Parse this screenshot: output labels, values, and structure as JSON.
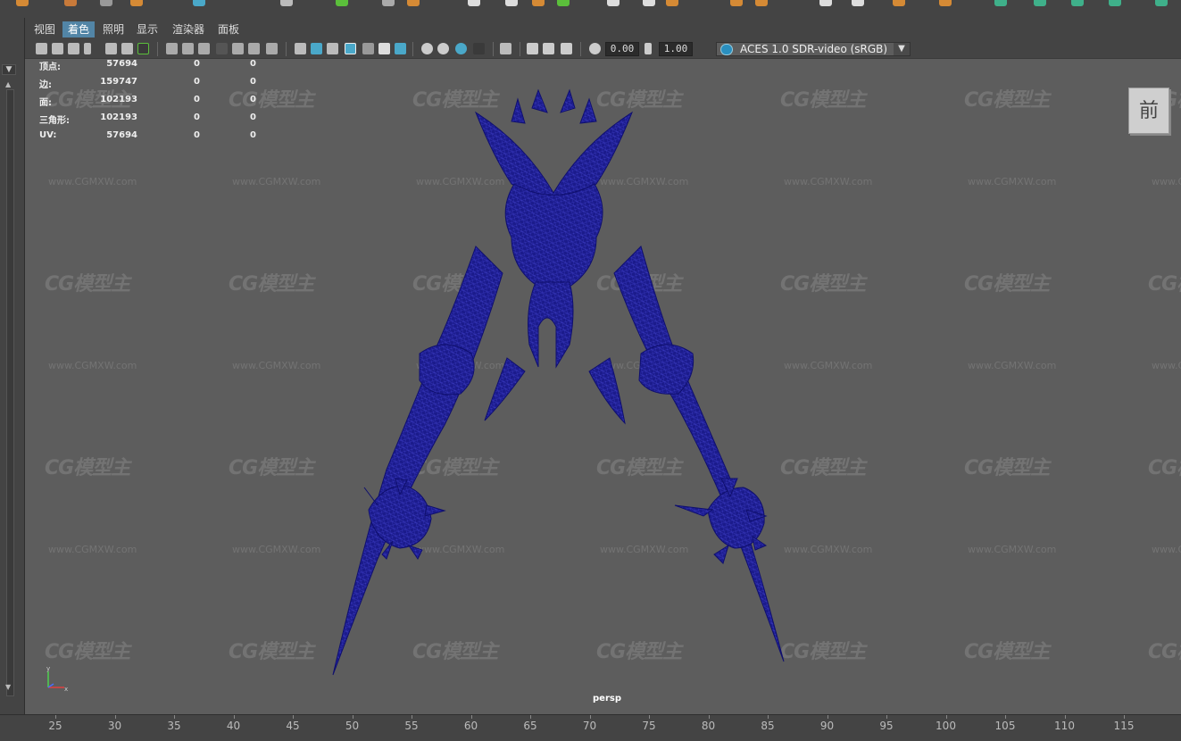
{
  "menu": {
    "items": [
      "视图",
      "着色",
      "照明",
      "显示",
      "渲染器",
      "面板"
    ],
    "active_index": 1
  },
  "toolbar": {
    "exposure_value": "0.00",
    "gamma_value": "1.00",
    "color_management": "ACES 1.0 SDR-video (sRGB)"
  },
  "hud": {
    "rows": [
      {
        "label": "顶点:",
        "v1": "57694",
        "v2": "0",
        "v3": "0"
      },
      {
        "label": "边:",
        "v1": "159747",
        "v2": "0",
        "v3": "0"
      },
      {
        "label": "面:",
        "v1": "102193",
        "v2": "0",
        "v3": "0"
      },
      {
        "label": "三角形:",
        "v1": "102193",
        "v2": "0",
        "v3": "0"
      },
      {
        "label": "UV:",
        "v1": "57694",
        "v2": "0",
        "v3": "0"
      }
    ]
  },
  "viewport": {
    "camera": "persp",
    "view_cube_face": "前",
    "axis_y": "y",
    "axis_x": "x",
    "watermark_logo": "CG模型主",
    "watermark_url": "www.CGMXW.com",
    "mesh_color": "#1a1a8c",
    "background_color": "#5d5d5d"
  },
  "timeline": {
    "ticks": [
      "25",
      "30",
      "35",
      "40",
      "45",
      "50",
      "55",
      "60",
      "65",
      "70",
      "75",
      "80",
      "85",
      "90",
      "95",
      "100",
      "105",
      "110",
      "115"
    ]
  },
  "colors": {
    "accent": "#5285a6",
    "ui_bg": "#444444"
  }
}
